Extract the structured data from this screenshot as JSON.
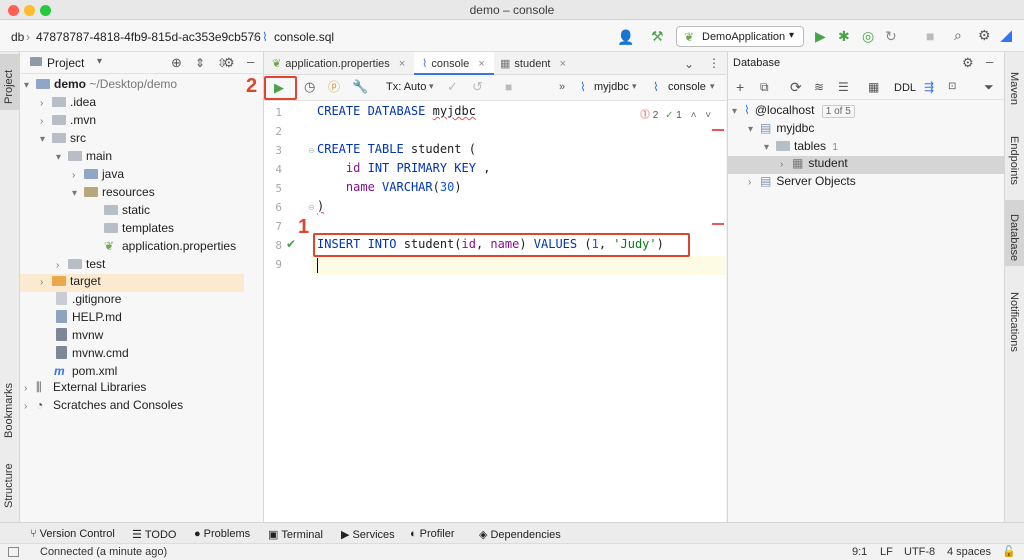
{
  "window": {
    "title": "demo – console"
  },
  "navbar": {
    "breadcrumb_root": "db",
    "breadcrumb_console_id": "47878787-4818-4fb9-815d-ac353e9cb576",
    "breadcrumb_file": "console.sql",
    "run_config": "DemoApplication"
  },
  "left_strip": {
    "project_tab": "Project",
    "bookmarks_tab": "Bookmarks",
    "structure_tab": "Structure"
  },
  "project": {
    "header": "Project",
    "tree": [
      {
        "label": "demo",
        "suffix": "~/Desktop/demo"
      },
      {
        "label": ".idea"
      },
      {
        "label": ".mvn"
      },
      {
        "label": "src"
      },
      {
        "label": "main"
      },
      {
        "label": "java"
      },
      {
        "label": "resources"
      },
      {
        "label": "static"
      },
      {
        "label": "templates"
      },
      {
        "label": "application.properties"
      },
      {
        "label": "test"
      },
      {
        "label": "target"
      },
      {
        "label": ".gitignore"
      },
      {
        "label": "HELP.md"
      },
      {
        "label": "mvnw"
      },
      {
        "label": "mvnw.cmd"
      },
      {
        "label": "pom.xml"
      },
      {
        "label": "External Libraries"
      },
      {
        "label": "Scratches and Consoles"
      }
    ]
  },
  "editor": {
    "tabs": [
      {
        "label": "application.properties"
      },
      {
        "label": "console"
      },
      {
        "label": "student"
      }
    ],
    "toolbar": {
      "tx_mode": "Tx: Auto",
      "datasource": "myjdbc",
      "session": "console",
      "errors": "2",
      "checks": "1"
    },
    "line_numbers": [
      "1",
      "2",
      "3",
      "4",
      "5",
      "6",
      "7",
      "8",
      "9"
    ],
    "code": {
      "l1_kw": "CREATE DATABASE",
      "l1_id": "myjdbc",
      "l3_kw": "CREATE TABLE",
      "l3_rest": " student (",
      "l4_col": "id",
      "l4_type": "INT PRIMARY KEY",
      "l4_rest": " ,",
      "l5_col": "name",
      "l5_type": "VARCHAR",
      "l5_num": "30",
      "l5_open": "(",
      "l5_close": ")",
      "l6": ")",
      "l8_kw1": "INSERT INTO",
      "l8_tbl": " student(",
      "l8_c1": "id",
      "l8_sep": ", ",
      "l8_c2": "name",
      "l8_mid": ") ",
      "l8_kw2": "VALUES",
      "l8_open": " (",
      "l8_num": "1",
      "l8_comma": ", ",
      "l8_str": "'Judy'",
      "l8_close": ")"
    }
  },
  "annotations": {
    "one": "1",
    "two": "2"
  },
  "database": {
    "header": "Database",
    "toolbar_ddl": "DDL",
    "tree": [
      {
        "label": "@localhost",
        "badge": "1 of 5"
      },
      {
        "label": "myjdbc"
      },
      {
        "label": "tables",
        "badge": "1"
      },
      {
        "label": "student"
      },
      {
        "label": "Server Objects"
      }
    ]
  },
  "right_strip": {
    "maven": "Maven",
    "endpoints": "Endpoints",
    "database": "Database",
    "notifications": "Notifications"
  },
  "bottom_tabs": [
    "Version Control",
    "TODO",
    "Problems",
    "Terminal",
    "Services",
    "Profiler",
    "Dependencies"
  ],
  "status": {
    "message": "Connected (a minute ago)",
    "position": "9:1",
    "line_sep": "LF",
    "encoding": "UTF-8",
    "indent": "4 spaces"
  },
  "colors": {
    "accent": "#3574f0",
    "annotation": "#e0442d",
    "run_green": "#4aa34a"
  }
}
